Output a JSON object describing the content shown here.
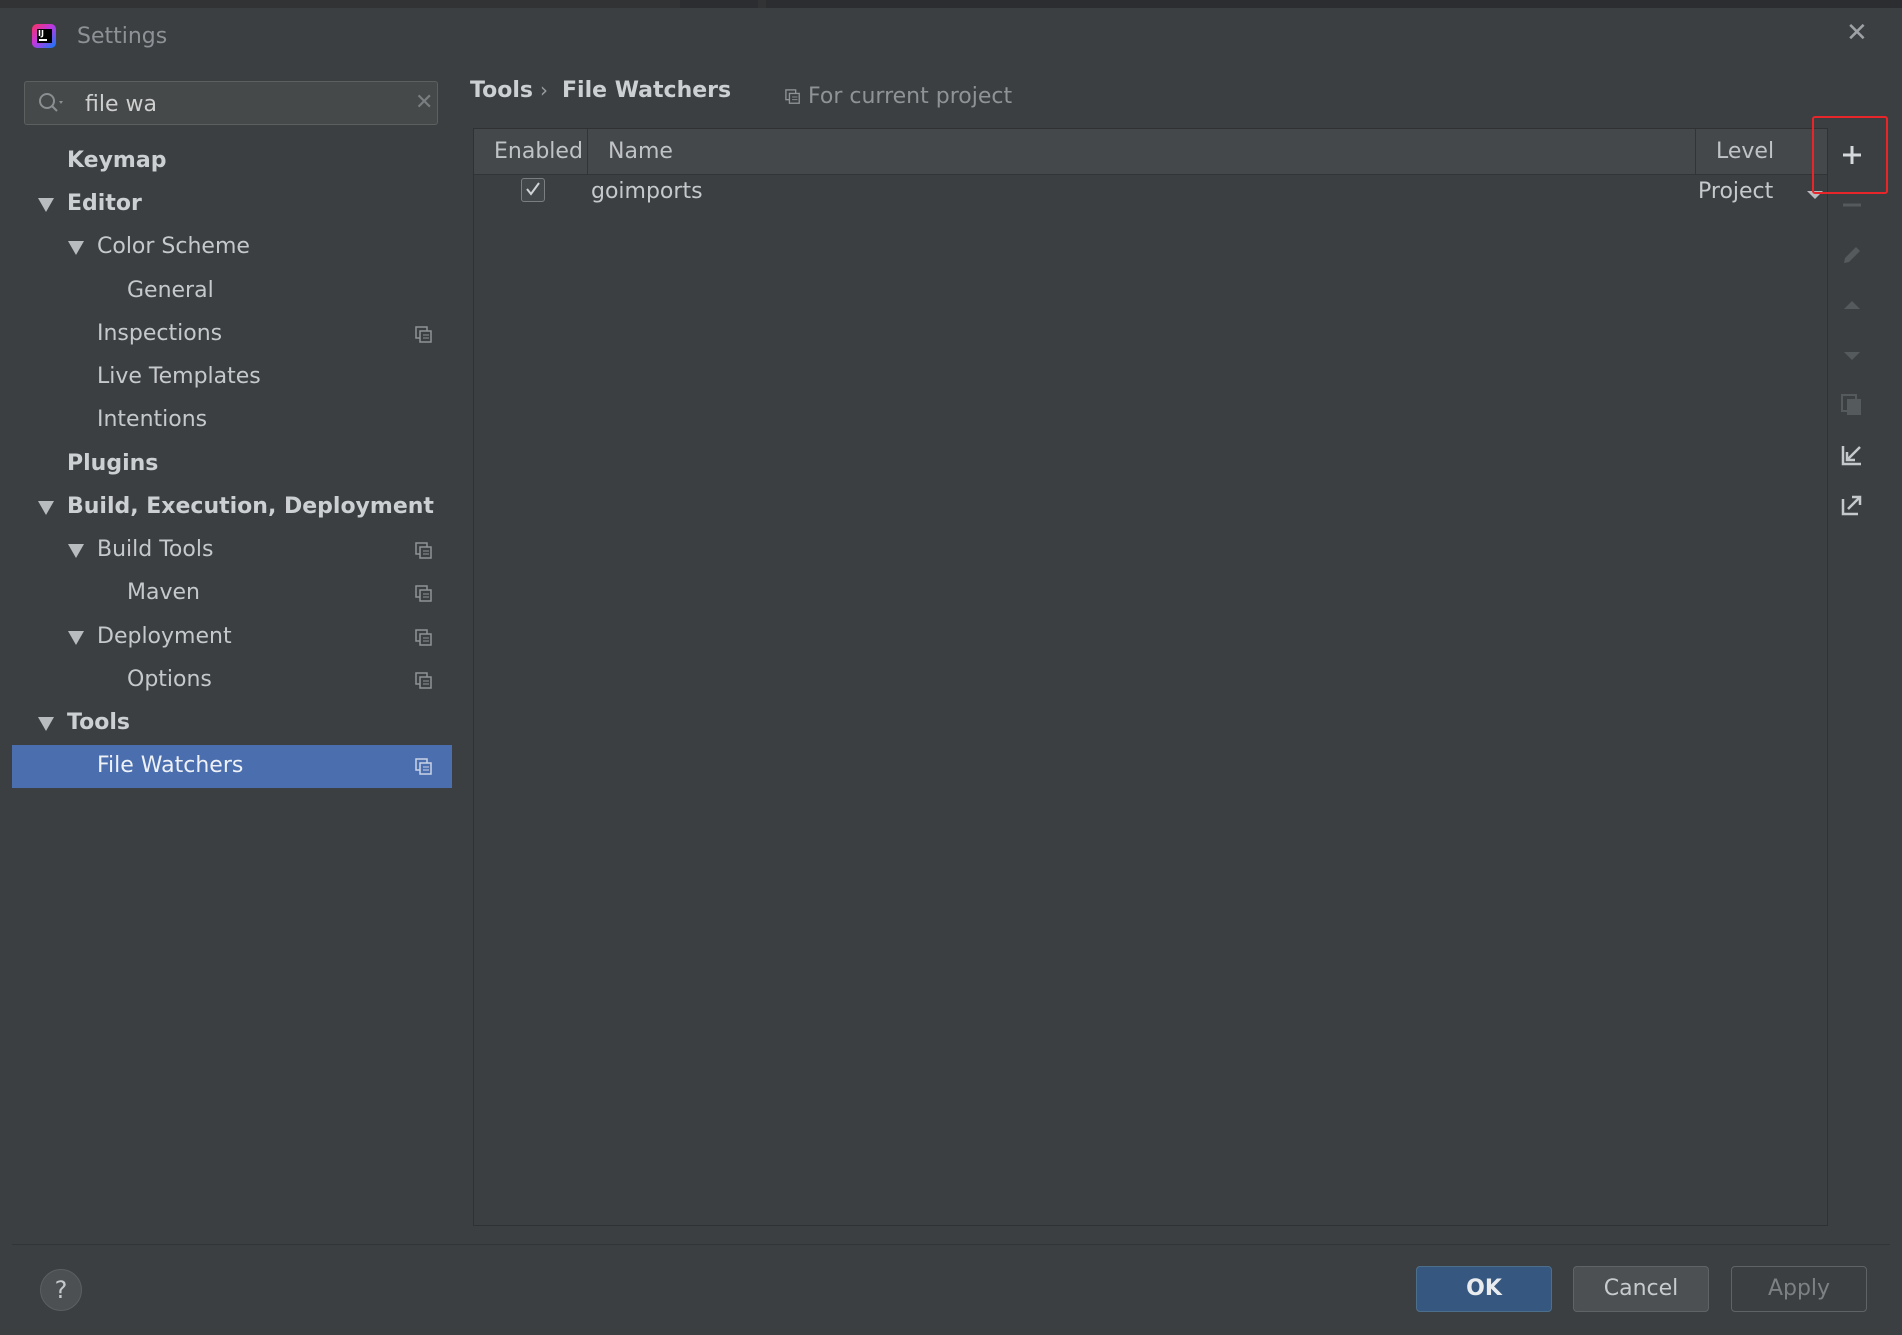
{
  "window": {
    "title": "Settings",
    "close_glyph": "✕"
  },
  "search": {
    "value": "file wa",
    "placeholder": ""
  },
  "sidebar": {
    "items": [
      {
        "label": "Keymap"
      },
      {
        "label": "Editor"
      },
      {
        "label": "Color Scheme"
      },
      {
        "label": "General"
      },
      {
        "label": "Inspections"
      },
      {
        "label": "Live Templates"
      },
      {
        "label": "Intentions"
      },
      {
        "label": "Plugins"
      },
      {
        "label": "Build, Execution, Deployment"
      },
      {
        "label": "Build Tools"
      },
      {
        "label": "Maven"
      },
      {
        "label": "Deployment"
      },
      {
        "label": "Options"
      },
      {
        "label": "Tools"
      },
      {
        "label": "File Watchers"
      }
    ]
  },
  "breadcrumb": {
    "part1": "Tools",
    "separator": "›",
    "part2": "File Watchers"
  },
  "scope": {
    "label": "For current project"
  },
  "table": {
    "columns": {
      "enabled": "Enabled",
      "name": "Name",
      "level": "Level"
    },
    "rows": [
      {
        "enabled": true,
        "name": "goimports",
        "level": "Project"
      }
    ]
  },
  "toolbar": {
    "add": "add-icon",
    "remove": "remove-icon",
    "edit": "edit-icon",
    "move_up": "move-up-icon",
    "move_down": "move-down-icon",
    "copy": "copy-icon",
    "import": "import-icon",
    "export": "export-icon"
  },
  "footer": {
    "help_label": "?",
    "ok_label": "OK",
    "cancel_label": "Cancel",
    "apply_label": "Apply"
  },
  "colors": {
    "selection": "#4b6eaf",
    "highlight_box": "#e8262a",
    "ok_button": "#365880"
  }
}
